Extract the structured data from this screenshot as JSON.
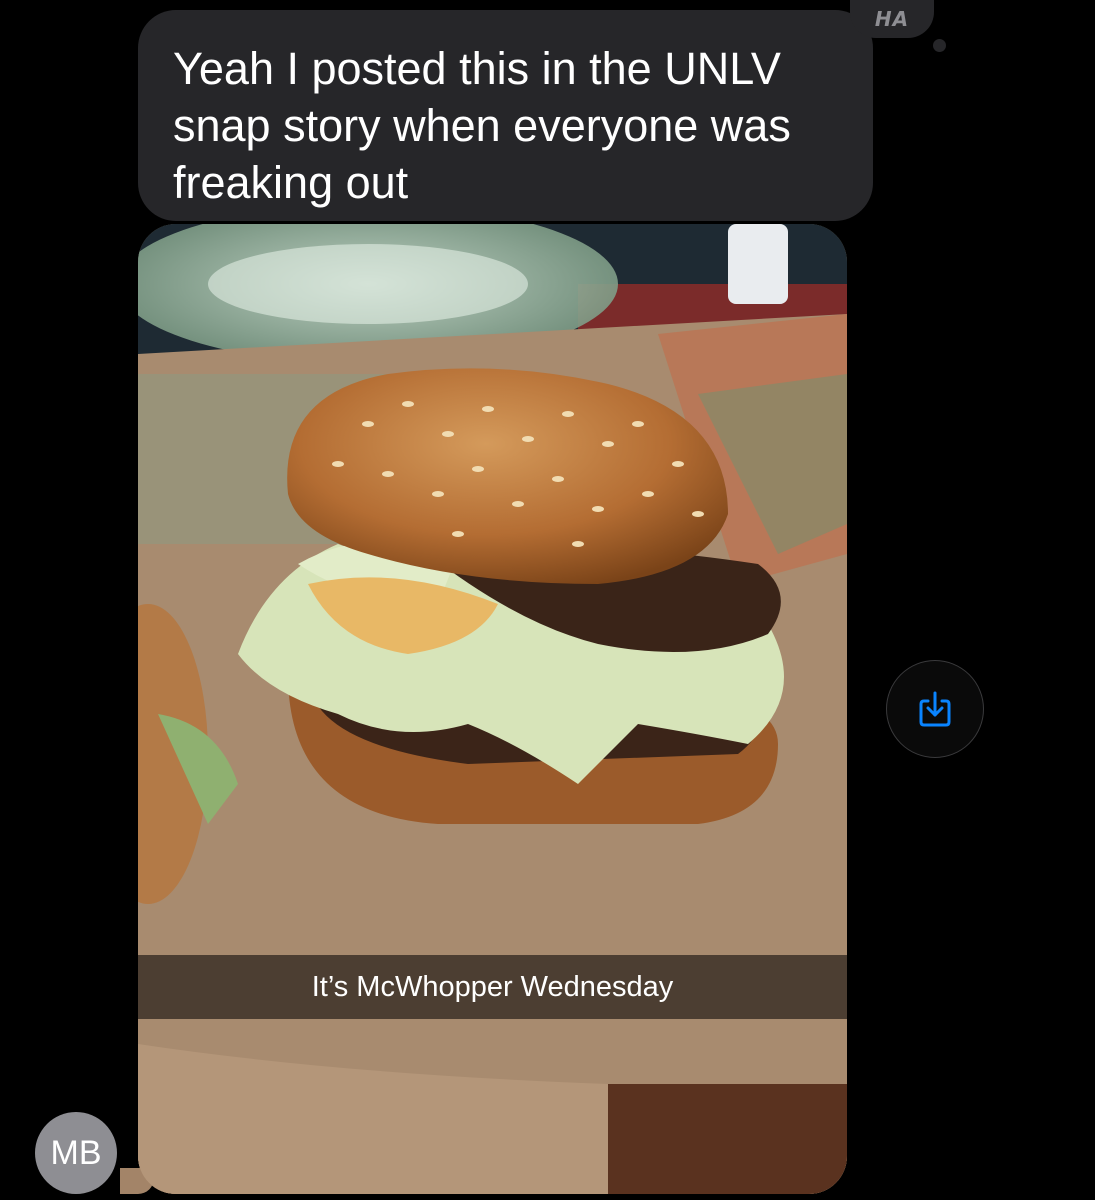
{
  "message": {
    "text": "Yeah I posted this in the UNLV snap story when everyone was freaking out",
    "tapback": "HA"
  },
  "photo": {
    "caption": "It’s McWhopper Wednesday"
  },
  "sender": {
    "initials": "MB"
  },
  "actions": {
    "save_icon": "save-download-icon"
  },
  "colors": {
    "background": "#000000",
    "bubble": "#262629",
    "accent": "#0a84ff",
    "avatar": "#8e8e93"
  }
}
